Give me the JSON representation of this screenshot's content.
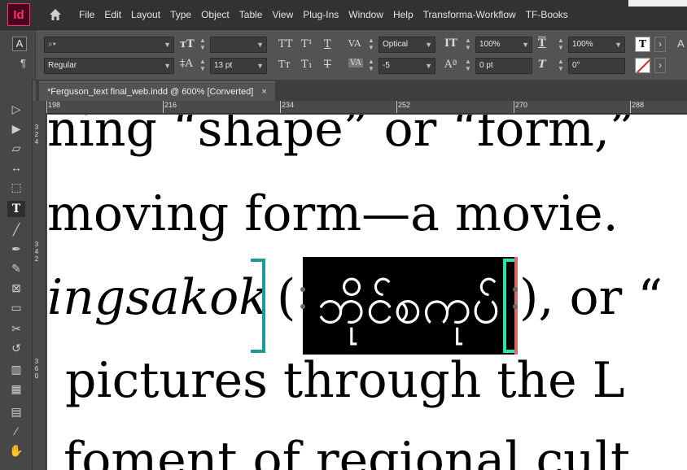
{
  "app": {
    "logo": "Id"
  },
  "menu": [
    "File",
    "Edit",
    "Layout",
    "Type",
    "Object",
    "Table",
    "View",
    "Plug-Ins",
    "Window",
    "Help",
    "Transforma-Workflow",
    "TF-Books"
  ],
  "control": {
    "mode_char": "A",
    "mode_para": "¶",
    "font_family_value": "",
    "font_style_value": "Regular",
    "font_size_value": "",
    "leading_value": "13 pt",
    "kerning_value": "Optical",
    "tracking_value": "-5",
    "vscale_value": "100%",
    "hscale_value": "100%",
    "baseline_value": "0 pt",
    "skew_value": "0°",
    "tt_label": "TT",
    "tsup_label": "T¹",
    "tu_label": "T",
    "tsmall_label": "Tт",
    "tsub_label": "T₁",
    "tstrike_label": "T",
    "va_label": "VA",
    "ta_label": "tA",
    "tt2_label": "IT",
    "t_label": "T",
    "aa_label": "Aª",
    "t2_label": "T",
    "a_label": "A",
    "more": "›"
  },
  "tab": {
    "title": "*Ferguson_text final_web.indd @ 600% [Converted]",
    "close": "×"
  },
  "ruler": {
    "top": [
      "198",
      "216",
      "234",
      "252",
      "270",
      "288"
    ],
    "left": [
      [
        "3",
        "2",
        "4"
      ],
      [
        "3",
        "4",
        "2"
      ],
      [
        "3",
        "6",
        "0"
      ]
    ]
  },
  "doc": {
    "line1": "ning “shape” or “form,”",
    "line2": "moving form—a movie.",
    "line3a": "ingsakok",
    "line3b": "(",
    "burmese": "ဘိုင်စကုပ်",
    "line3c": "), or “",
    "line4": "pictures through the L",
    "line5": "foment of regional cult"
  },
  "colors": {
    "accent_teal": "#1d9a9a",
    "accent_green": "#2de0b0",
    "brand_pink": "#ff3366",
    "hidden_char_blue": "#5aa0e8"
  },
  "icons": [
    "home-icon",
    "selection-tool-icon",
    "direct-selection-tool-icon",
    "page-tool-icon",
    "gap-tool-icon",
    "content-collector-icon",
    "type-tool-icon",
    "line-tool-icon",
    "pen-tool-icon",
    "pencil-tool-icon",
    "rectangle-frame-tool-icon",
    "rectangle-tool-icon",
    "scissors-tool-icon",
    "free-transform-tool-icon",
    "gradient-swatch-tool-icon",
    "gradient-feather-tool-icon",
    "note-tool-icon",
    "eyedropper-tool-icon",
    "hand-tool-icon"
  ]
}
